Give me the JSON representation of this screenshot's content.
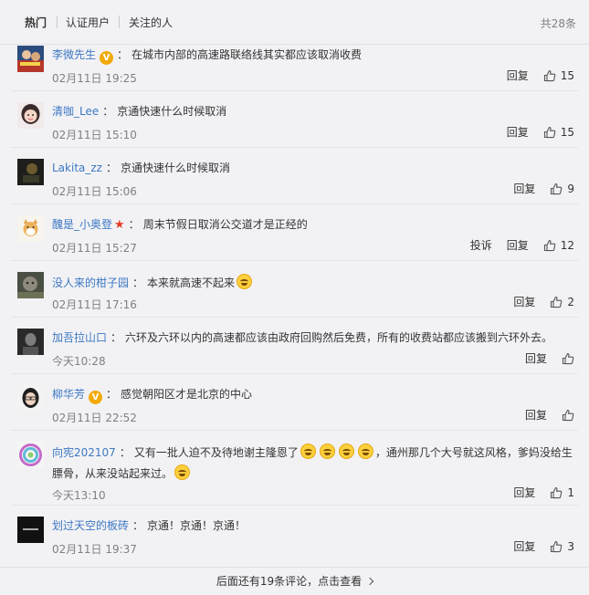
{
  "tabs": {
    "hot": "热门",
    "verified": "认证用户",
    "following": "关注的人"
  },
  "total": "共28条",
  "actions": {
    "reply": "回复",
    "report": "投诉"
  },
  "colon": "：",
  "comments": [
    {
      "user": "李微先生",
      "text": "在城市内部的高速路联络线其实都应该取消收费",
      "time": "02月11日 19:25",
      "likes": "15"
    },
    {
      "user": "清咖_Lee",
      "text": "京通快速什么时候取消",
      "time": "02月11日 15:10",
      "likes": "15"
    },
    {
      "user": "Lakita_zz",
      "text": "京通快速什么时候取消",
      "time": "02月11日 15:06",
      "likes": "9"
    },
    {
      "user": "醜是_小奥登",
      "text": "周末节假日取消公交道才是正经的",
      "time": "02月11日 15:27",
      "likes": "12"
    },
    {
      "user": "没人来的柑子园",
      "text": "本来就高速不起来",
      "time": "02月11日 17:16",
      "likes": "2"
    },
    {
      "user": "加吾拉山口",
      "text": "六环及六环以内的高速都应该由政府回购然后免费，所有的收费站都应该搬到六环外去。",
      "time": "今天10:28",
      "likes": ""
    },
    {
      "user": "柳华芳",
      "text": "感觉朝阳区才是北京的中心",
      "time": "02月11日 22:52",
      "likes": ""
    },
    {
      "user": "向宪202107",
      "text_a": "又有一批人迫不及待地谢主隆恩了",
      "text_b": "，通州那几个大号就这风格，爹妈没给生",
      "text_c": "膘骨，从来没站起来过。",
      "time": "今天13:10",
      "likes": "1"
    },
    {
      "user": "划过天空的板砖",
      "text": "京通！京通！京通！",
      "time": "02月11日 19:37",
      "likes": "3"
    }
  ],
  "footer": "后面还有19条评论，点击查看",
  "colors": {
    "link": "#3d78c2",
    "background": "#f2f2f5",
    "text": "#333333",
    "muted": "#808080"
  }
}
